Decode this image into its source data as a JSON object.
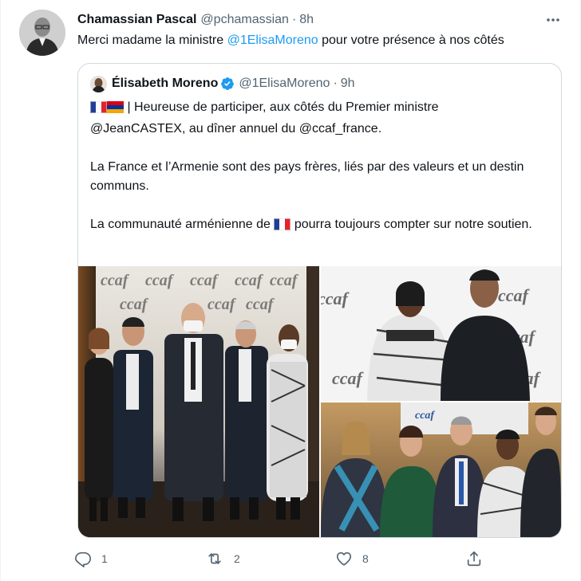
{
  "tweet": {
    "author_name": "Chamassian Pascal",
    "handle": "@pchamassian",
    "separator": "·",
    "time": "8h",
    "text_before": "Merci madame la ministre ",
    "text_mention": "@1ElisaMoreno",
    "text_after": " pour votre présence à nos côtés"
  },
  "quoted": {
    "author_name": "Élisabeth Moreno",
    "handle": "@1ElisaMoreno",
    "separator": "·",
    "time": "9h",
    "line1": " | Heureuse de participer, aux côtés du Premier ministre",
    "line2": "@JeanCASTEX, au dîner annuel du @ccaf_france.",
    "para2": "La France et l’Armenie sont des pays frères, liés par des valeurs et un destin communs.",
    "para3_before": "La communauté arménienne de ",
    "para3_after": " pourra toujours compter sur notre soutien.",
    "photo_sign_text": "ccaf"
  },
  "actions": {
    "reply_count": "1",
    "retweet_count": "2",
    "like_count": "8"
  },
  "icons": {
    "more": "more-dots-icon",
    "verified": "verified-badge-icon",
    "reply": "reply-icon",
    "retweet": "retweet-icon",
    "like": "heart-icon",
    "share": "share-icon"
  },
  "colors": {
    "link": "#1d9bf0",
    "secondary_text": "#536471",
    "border": "#cfd9de",
    "verified": "#1d9bf0"
  }
}
